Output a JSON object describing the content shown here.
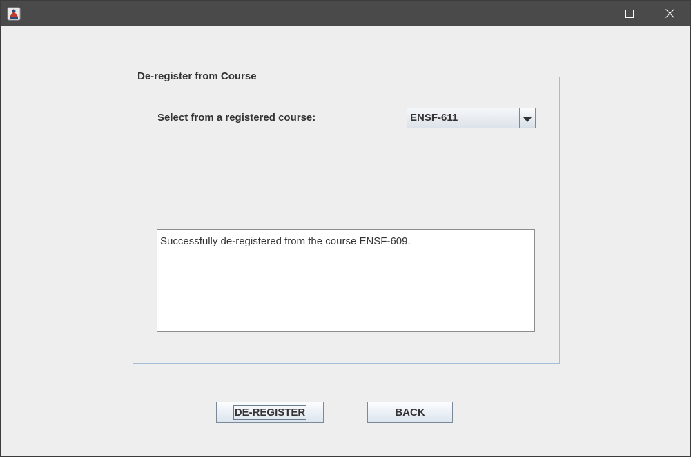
{
  "window": {
    "app_icon": "java-app-icon",
    "controls": {
      "minimize": "minimize-icon",
      "maximize": "maximize-icon",
      "close": "close-icon"
    }
  },
  "panel": {
    "title": "De-register from Course",
    "select_label": "Select from a registered course:",
    "course_select": {
      "selected": "ENSF-611",
      "arrow_icon": "chevron-down-icon"
    },
    "message": "Successfully de-registered from the course ENSF-609."
  },
  "actions": {
    "deregister_label": "DE-REGISTER",
    "back_label": "BACK"
  },
  "colors": {
    "titlebar": "#4a4a4a",
    "background": "#eeeeee",
    "group_border": "#a3bdd6",
    "text": "#333333"
  }
}
